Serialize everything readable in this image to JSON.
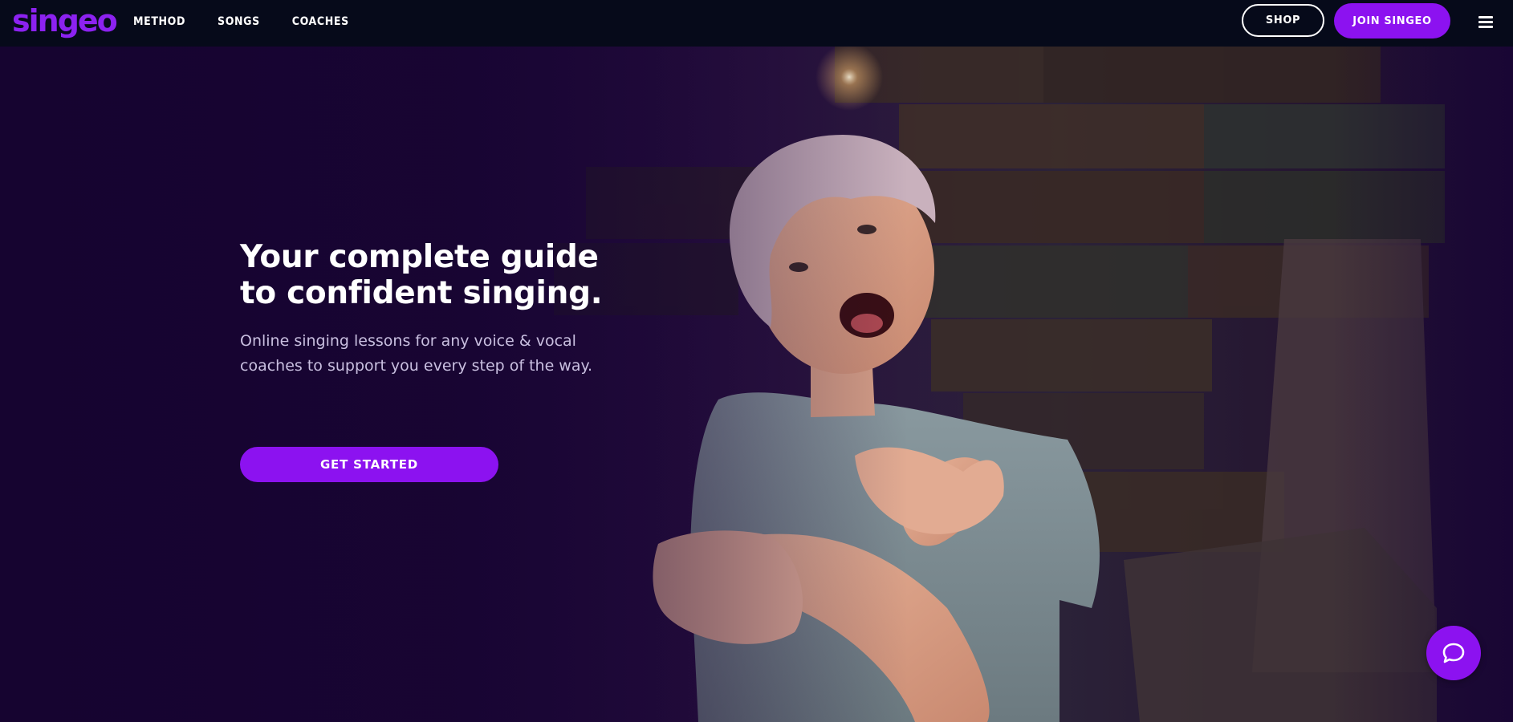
{
  "brand": {
    "logo_text": "singeo",
    "accent_color": "#8c12f0"
  },
  "nav": {
    "links": [
      {
        "label": "METHOD"
      },
      {
        "label": "SONGS"
      },
      {
        "label": "COACHES"
      }
    ],
    "shop_label": "SHOP",
    "join_label": "JOIN SINGEO",
    "menu_icon": "hamburger-menu-icon"
  },
  "hero": {
    "title": "Your complete guide to confident singing.",
    "subtitle": "Online singing lessons for any voice & vocal coaches to support you every step of the way.",
    "cta_label": "GET STARTED",
    "image_alt": "Smiling singer with short blonde hair reaching out with open hands"
  },
  "chat": {
    "icon": "chat-bubble-icon"
  }
}
